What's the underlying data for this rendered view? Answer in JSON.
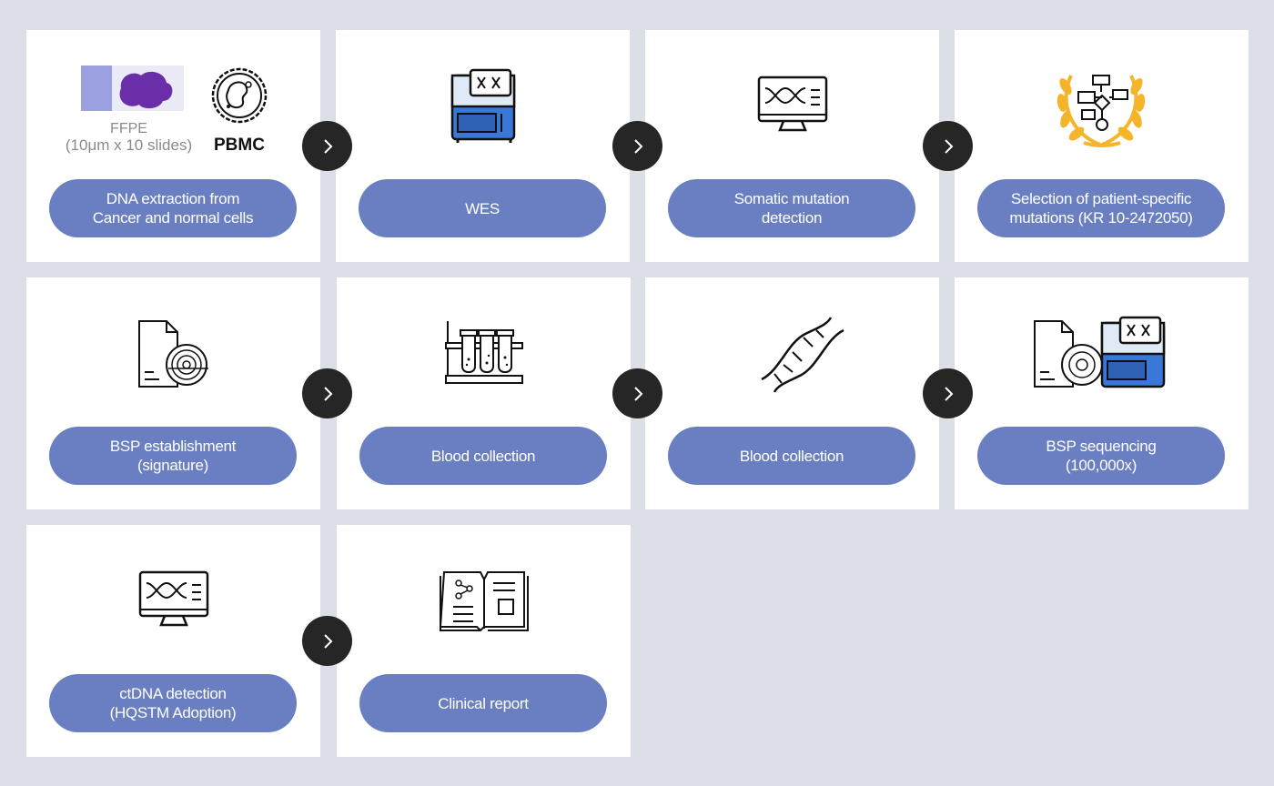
{
  "steps": [
    {
      "lines": [
        "DNA extraction from",
        "Cancer and normal cells"
      ],
      "icon": "ffpe-pbmc-icon",
      "captions": {
        "ffpe_title": "FFPE",
        "ffpe_sub": "(10μm x 10 slides)",
        "pbmc": "PBMC"
      }
    },
    {
      "lines": [
        "WES"
      ],
      "icon": "sequencer-icon"
    },
    {
      "lines": [
        "Somatic mutation",
        "detection"
      ],
      "icon": "dna-monitor-icon"
    },
    {
      "lines": [
        "Selection of patient-specific",
        "mutations (KR 10-2472050)"
      ],
      "icon": "laurel-flowchart-icon"
    },
    {
      "lines": [
        "BSP establishment",
        "(signature)"
      ],
      "icon": "fingerprint-document-icon"
    },
    {
      "lines": [
        "Blood collection"
      ],
      "icon": "test-tubes-icon"
    },
    {
      "lines": [
        "Blood collection"
      ],
      "icon": "dna-helix-icon"
    },
    {
      "lines": [
        "BSP sequencing",
        "(100,000x)"
      ],
      "icon": "fingerprint-sequencer-icon"
    },
    {
      "lines": [
        "ctDNA detection",
        "(HQSTM Adoption)"
      ],
      "icon": "dna-monitor-icon"
    },
    {
      "lines": [
        "Clinical report"
      ],
      "icon": "open-book-icon"
    }
  ],
  "colors": {
    "pill": "#6a7fc1",
    "arrow": "#262626",
    "background": "#dcdfe6",
    "accent_blue": "#3a78d8",
    "accent_gold": "#f5b52a"
  }
}
